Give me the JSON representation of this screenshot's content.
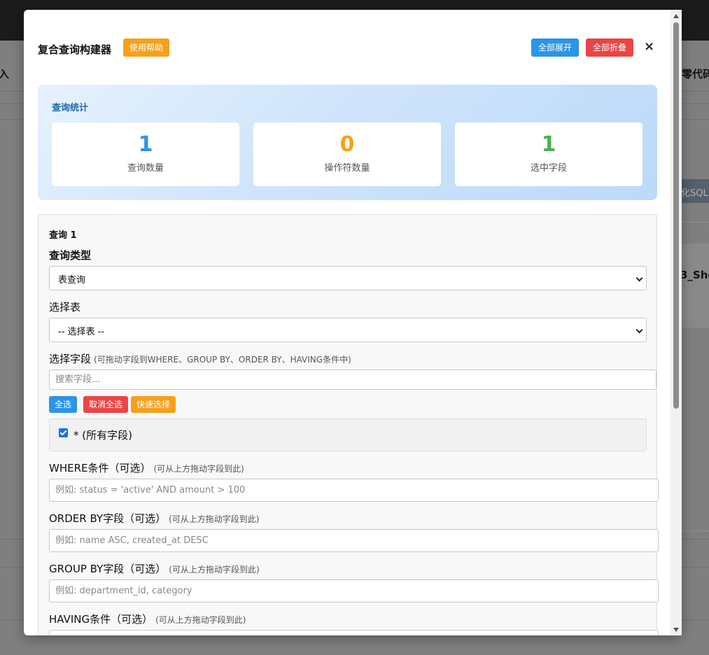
{
  "background": {
    "left_text": "入",
    "right_text": "零代码",
    "right_button": "化SQL",
    "card_text": "3_She"
  },
  "modal": {
    "title": "复合查询构建器",
    "help_label": "使用帮助",
    "expand_label": "全部展开",
    "collapse_label": "全部折叠",
    "close_label": "×"
  },
  "stats": {
    "title": "查询统计",
    "cards": [
      {
        "value": "1",
        "label": "查询数量",
        "color": "#2b95e8"
      },
      {
        "value": "0",
        "label": "操作符数量",
        "color": "#f7a01b"
      },
      {
        "value": "1",
        "label": "选中字段",
        "color": "#4caf50"
      }
    ]
  },
  "query": {
    "title": "查询 1",
    "type_label": "查询类型",
    "type_value": "表查询",
    "table_label": "选择表",
    "table_value": "-- 选择表 --",
    "fields_label": "选择字段",
    "fields_hint": "(可拖动字段到WHERE、GROUP BY、ORDER BY、HAVING条件中)",
    "search_placeholder": "搜索字段...",
    "select_all": "全选",
    "deselect_all": "取消全选",
    "quick_select": "快速选择",
    "field_option": "* (所有字段)",
    "where_label": "WHERE条件（可选）",
    "where_hint": "(可从上方拖动字段到此)",
    "where_placeholder": "例如: status = 'active' AND amount > 100",
    "order_label": "ORDER BY字段（可选）",
    "order_hint": "(可从上方拖动字段到此)",
    "order_placeholder": "例如: name ASC, created_at DESC",
    "group_label": "GROUP BY字段（可选）",
    "group_hint": "(可从上方拖动字段到此)",
    "group_placeholder": "例如: department_id, category",
    "having_label": "HAVING条件（可选）",
    "having_hint": "(可从上方拖动字段到此)"
  }
}
